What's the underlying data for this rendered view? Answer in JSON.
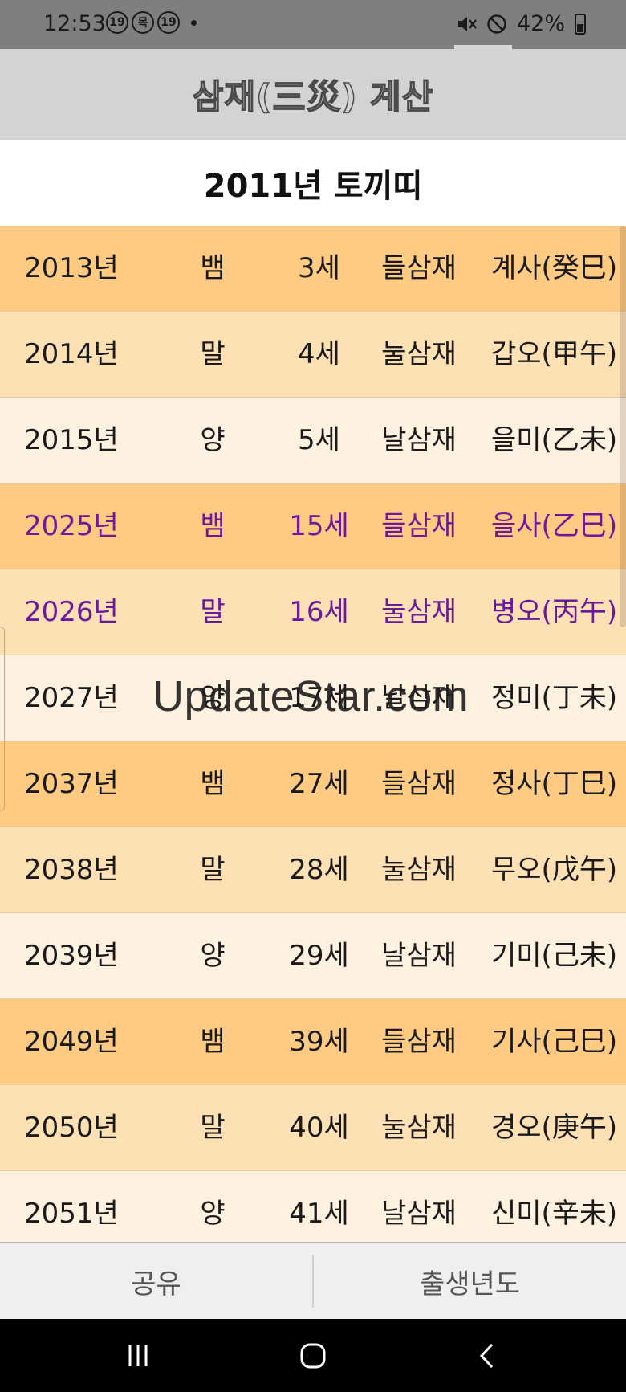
{
  "status_bar": {
    "time": "12:53",
    "notif_icons": [
      "19",
      "목",
      "19"
    ],
    "battery": "42%"
  },
  "app": {
    "title": "삼재(三災) 계산",
    "subtitle": "2011년 토끼띠"
  },
  "rows": [
    {
      "year": "2013년",
      "animal": "뱀",
      "age": "3세",
      "type": "들삼재",
      "ganji": "계사(癸巳)",
      "highlight": false
    },
    {
      "year": "2014년",
      "animal": "말",
      "age": "4세",
      "type": "눌삼재",
      "ganji": "갑오(甲午)",
      "highlight": false
    },
    {
      "year": "2015년",
      "animal": "양",
      "age": "5세",
      "type": "날삼재",
      "ganji": "을미(乙未)",
      "highlight": false
    },
    {
      "year": "2025년",
      "animal": "뱀",
      "age": "15세",
      "type": "들삼재",
      "ganji": "을사(乙巳)",
      "highlight": true
    },
    {
      "year": "2026년",
      "animal": "말",
      "age": "16세",
      "type": "눌삼재",
      "ganji": "병오(丙午)",
      "highlight": true
    },
    {
      "year": "2027년",
      "animal": "양",
      "age": "17세",
      "type": "날삼재",
      "ganji": "정미(丁未)",
      "highlight": false
    },
    {
      "year": "2037년",
      "animal": "뱀",
      "age": "27세",
      "type": "들삼재",
      "ganji": "정사(丁巳)",
      "highlight": false
    },
    {
      "year": "2038년",
      "animal": "말",
      "age": "28세",
      "type": "눌삼재",
      "ganji": "무오(戊午)",
      "highlight": false
    },
    {
      "year": "2039년",
      "animal": "양",
      "age": "29세",
      "type": "날삼재",
      "ganji": "기미(己未)",
      "highlight": false
    },
    {
      "year": "2049년",
      "animal": "뱀",
      "age": "39세",
      "type": "들삼재",
      "ganji": "기사(己巳)",
      "highlight": false
    },
    {
      "year": "2050년",
      "animal": "말",
      "age": "40세",
      "type": "눌삼재",
      "ganji": "경오(庚午)",
      "highlight": false
    },
    {
      "year": "2051년",
      "animal": "양",
      "age": "41세",
      "type": "날삼재",
      "ganji": "신미(辛未)",
      "highlight": false
    }
  ],
  "watermark": "UpdateStar.com",
  "bottom": {
    "share_label": "공유",
    "birth_year_label": "출생년도"
  },
  "nav": {
    "recent_icon": "recent-apps-icon",
    "home_icon": "home-icon",
    "back_icon": "back-icon"
  },
  "colors": {
    "row_dark": "#ffcb82",
    "row_mid": "#fde0b4",
    "row_light": "#fff1df",
    "highlight_text": "#6a1b9a",
    "appbar_bg": "#d3d3d3",
    "statusbar_bg": "#7f7f7f"
  }
}
